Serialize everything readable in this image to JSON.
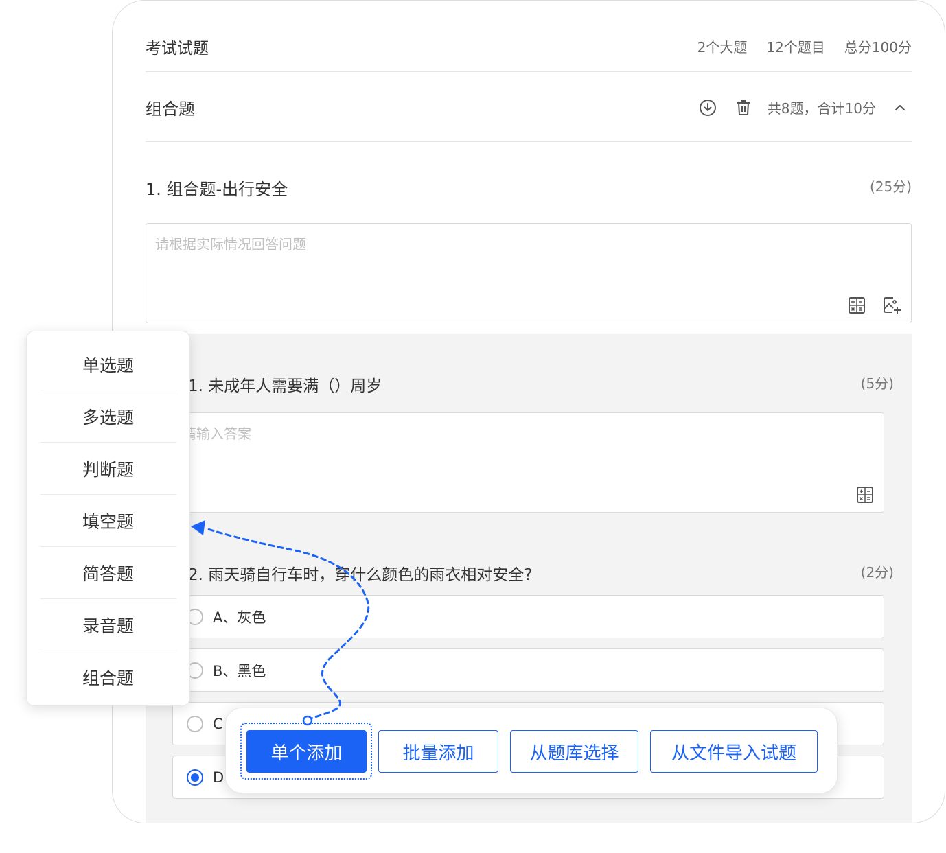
{
  "exam": {
    "title": "考试试题",
    "stats": [
      "2个大题",
      "12个题目",
      "总分100分"
    ]
  },
  "section": {
    "title": "组合题",
    "summary": "共8题，合计10分"
  },
  "question": {
    "title": "1. 组合题-出行安全",
    "score": "(25分)",
    "placeholder": "请根据实际情况回答问题"
  },
  "sub_questions": [
    {
      "title": "1. 未成年人需要满（）周岁",
      "score": "(5分)",
      "placeholder": "请输入答案"
    },
    {
      "title": "2. 雨天骑自行车时，穿什么颜色的雨衣相对安全?",
      "score": "(2分)",
      "options": [
        {
          "label": "A、灰色",
          "checked": false
        },
        {
          "label": "B、黑色",
          "checked": false
        },
        {
          "label": "C",
          "checked": false
        },
        {
          "label": "D",
          "checked": true
        }
      ]
    }
  ],
  "dropdown": {
    "items": [
      "单选题",
      "多选题",
      "判断题",
      "填空题",
      "简答题",
      "录音题",
      "组合题"
    ]
  },
  "toolbar": {
    "single_add": "单个添加",
    "batch_add": "批量添加",
    "from_bank": "从题库选择",
    "from_file": "从文件导入试题"
  },
  "colors": {
    "accent": "#1a63f5",
    "border": "#d9d9d9",
    "subarea_bg": "#f3f3f3"
  },
  "icons": [
    "download-circle-icon",
    "trash-icon",
    "chevron-up-icon",
    "formula-icon",
    "add-image-icon"
  ]
}
